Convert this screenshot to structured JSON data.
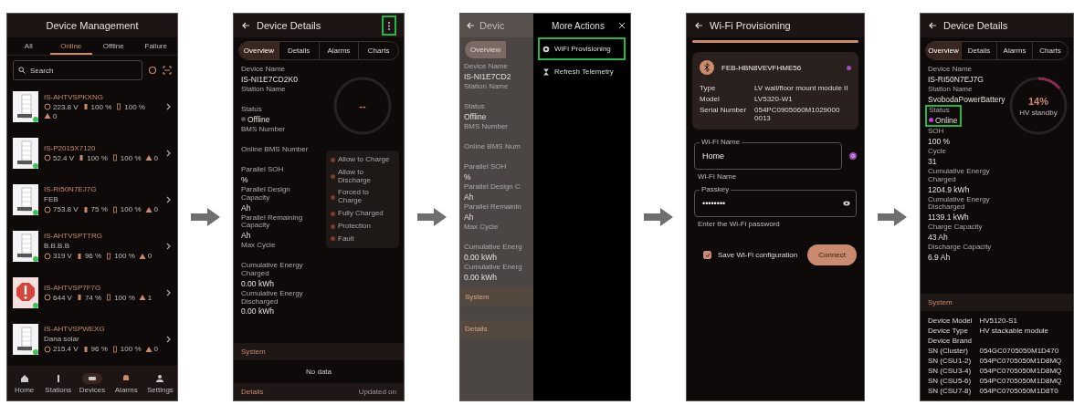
{
  "screens": [
    {
      "kind": "device_list",
      "title": "Device Management",
      "tabs": [
        {
          "label": "All",
          "selected": false
        },
        {
          "label": "Online",
          "selected": true
        },
        {
          "label": "Offline",
          "selected": false
        },
        {
          "label": "Failure",
          "selected": false
        }
      ],
      "search": {
        "placeholder": "Search"
      },
      "devices": [
        {
          "name": "IS-AHTVSPKXNG",
          "alarm": false,
          "online": true,
          "voltage": "223.8 V",
          "soc": "100 %",
          "soh": "100 %",
          "alarms": "0"
        },
        {
          "name": "IS-P2015X7120",
          "alarm": false,
          "online": true,
          "voltage": "52.4 V",
          "soc": "100 %",
          "soh": "100 %",
          "alarms": "0"
        },
        {
          "name": "IS-RI50N7EJ7G",
          "note": "FEB",
          "alarm": false,
          "online": true,
          "voltage": "753.8 V",
          "soc": "75 %",
          "soh": "100 %",
          "alarms": "0"
        },
        {
          "name": "IS-AHTVSPTTRG",
          "note": "B.B.B.B",
          "alarm": false,
          "online": true,
          "voltage": "319 V",
          "soc": "96 %",
          "soh": "100 %",
          "alarms": "0"
        },
        {
          "name": "IS-AHTVSP7F7G",
          "alarm": true,
          "online": true,
          "voltage": "644 V",
          "soc": "74 %",
          "soh": "100 %",
          "alarms": "1"
        },
        {
          "name": "IS-AHTVSPWEXG",
          "note": "Dana solar",
          "alarm": false,
          "online": true,
          "voltage": "215.4 V",
          "soc": "96 %",
          "soh": "100 %",
          "alarms": "0"
        }
      ],
      "nav": [
        {
          "kind": "home",
          "label": "Home",
          "selected": false
        },
        {
          "kind": "stations",
          "label": "Stations",
          "selected": false
        },
        {
          "kind": "devices",
          "label": "Devices",
          "selected": true
        },
        {
          "kind": "alarms",
          "label": "Alarms",
          "selected": false
        },
        {
          "kind": "settings",
          "label": "Settings",
          "selected": false
        }
      ]
    },
    {
      "kind": "device_details",
      "title": "Device Details",
      "menu_highlighted": true,
      "tabs": [
        {
          "label": "Overview",
          "selected": true
        },
        {
          "label": "Details",
          "selected": false
        },
        {
          "label": "Alarms",
          "selected": false
        },
        {
          "label": "Charts",
          "selected": false
        }
      ],
      "fields": [
        {
          "kind": "text",
          "label": "Device Name",
          "value": "IS-NI1E7CD2K0"
        },
        {
          "kind": "text",
          "label": "Station Name"
        },
        {
          "kind": "status",
          "label": "Status",
          "value": "Offline",
          "online": false,
          "highlighted": false
        },
        {
          "kind": "text",
          "label": "BMS Number"
        },
        {
          "kind": "text",
          "label": "Online BMS Number"
        },
        {
          "kind": "text",
          "label": "Parallel SOH",
          "value": "%"
        },
        {
          "kind": "text",
          "label": "Parallel Design Capacity",
          "value": "Ah"
        },
        {
          "kind": "text",
          "label": "Parallel Remaining Capacity",
          "value": "Ah"
        },
        {
          "kind": "text",
          "label": "Max Cycle"
        },
        {
          "kind": "text",
          "label": "Cumulative Energy Charged",
          "value": "0.00 kWh"
        },
        {
          "kind": "text",
          "label": "Cumulative Energy Discharged",
          "value": "0.00 kWh"
        }
      ],
      "gauge": {
        "value": "--",
        "level": 0
      },
      "legend": [
        "Allow to Charge",
        "Allow to Discharge",
        "Forced to Charge",
        "Fully Charged",
        "Protection",
        "Fault"
      ],
      "sections": [
        {
          "title": "System",
          "empty": "No data"
        },
        {
          "title": "Details",
          "note": "Updated on"
        }
      ]
    },
    {
      "kind": "more_actions",
      "behind": {
        "title": "Devic",
        "tab": "Overview",
        "fields": [
          {
            "label": "Device Name",
            "value": "IS-NI1E7CD2"
          },
          {
            "label": "Station Name"
          },
          {
            "label": "Status",
            "value": "Offline"
          },
          {
            "label": "BMS Number"
          },
          {
            "label": "Online BMS Num"
          },
          {
            "label": "Parallel SOH",
            "value": "%"
          },
          {
            "label": "Parallel Design C",
            "value": "Ah"
          },
          {
            "label": "Parallel Remainin",
            "value": "Ah"
          },
          {
            "label": "Max Cycle"
          },
          {
            "label": "Cumulative Energ",
            "value": "0.00 kWh"
          },
          {
            "label": "Cumulative Energ",
            "value": "0.00 kWh"
          }
        ],
        "sections": [
          "System",
          "Details"
        ]
      },
      "drawer": {
        "title": "More Actions",
        "actions": [
          {
            "kind": "wifi",
            "label": "WiFi Provisioning",
            "highlighted": true
          },
          {
            "kind": "refresh",
            "label": "Refresh Telemetry",
            "highlighted": false
          }
        ]
      }
    },
    {
      "kind": "wifi_provisioning",
      "title": "Wi-Fi Provisioning",
      "progress": {
        "level": 1
      },
      "device": {
        "name": "FEB-HBN8VEVFHME56",
        "color": "#a24fc4",
        "specs": [
          {
            "label": "Type",
            "value": "LV wall/floor mount module II"
          },
          {
            "label": "Model",
            "value": "LV5320-W1"
          },
          {
            "label": "Serial Number",
            "value": "054PC0905060M1029000 0013"
          }
        ]
      },
      "inputs": [
        {
          "kind": "text",
          "label": "Wi-Fi Name",
          "value": "Home",
          "helper": "Wi-Fi Name"
        },
        {
          "kind": "password",
          "label": "Passkey",
          "value": "••••••••",
          "helper": "Enter the Wi-Fi password"
        }
      ],
      "save": {
        "label": "Save Wi-Fi configuration",
        "checked": true
      },
      "button": "Connect"
    },
    {
      "kind": "device_details",
      "title": "Device Details",
      "tabs": [
        {
          "label": "Overview",
          "selected": true
        },
        {
          "label": "Details",
          "selected": false
        },
        {
          "label": "Alarms",
          "selected": false
        },
        {
          "label": "Charts",
          "selected": false
        }
      ],
      "fields": [
        {
          "kind": "text",
          "label": "Device Name",
          "value": "IS-RI50N7EJ7G"
        },
        {
          "kind": "text",
          "label": "Station Name",
          "value": "SvobodaPowerBattery"
        },
        {
          "kind": "status",
          "label": "Status",
          "value": "Online",
          "online": true,
          "highlighted": true
        },
        {
          "kind": "text",
          "label": "SOH",
          "value": "100 %"
        },
        {
          "kind": "text",
          "label": "Cycle",
          "value": "31"
        },
        {
          "kind": "text",
          "label": "Cumulative Energy Charged",
          "value": "1204.9 kWh"
        },
        {
          "kind": "text",
          "label": "Cumulative Energy Discharged",
          "value": "1139.1 kWh"
        },
        {
          "kind": "text",
          "label": "Charge Capacity",
          "value": "43 Ah"
        },
        {
          "kind": "text",
          "label": "Discharge Capacity",
          "value": "6.9 Ah"
        }
      ],
      "gauge": {
        "value": "14%",
        "caption": "HV standby",
        "level": 0.14
      },
      "sections": [
        {
          "title": "System",
          "rows": [
            {
              "label": "Device Model",
              "value": "HV5120-S1"
            },
            {
              "label": "Device Type",
              "value": "HV stackable module"
            },
            {
              "label": "Device Brand"
            },
            {
              "label": "SN (Cluster)",
              "value": "054GC0705050M1D470"
            },
            {
              "label": "SN (CSU1-2)",
              "value": "054PC0705050M1D8MQ"
            },
            {
              "label": "SN (CSU3-4)",
              "value": "054PC0705050M1D8MQ"
            },
            {
              "label": "SN (CSU5-6)",
              "value": "054PC0705050M1D8MQ"
            },
            {
              "label": "SN (CSU7-8)",
              "value": "054PC0705050M1D8T0"
            }
          ]
        }
      ]
    }
  ]
}
